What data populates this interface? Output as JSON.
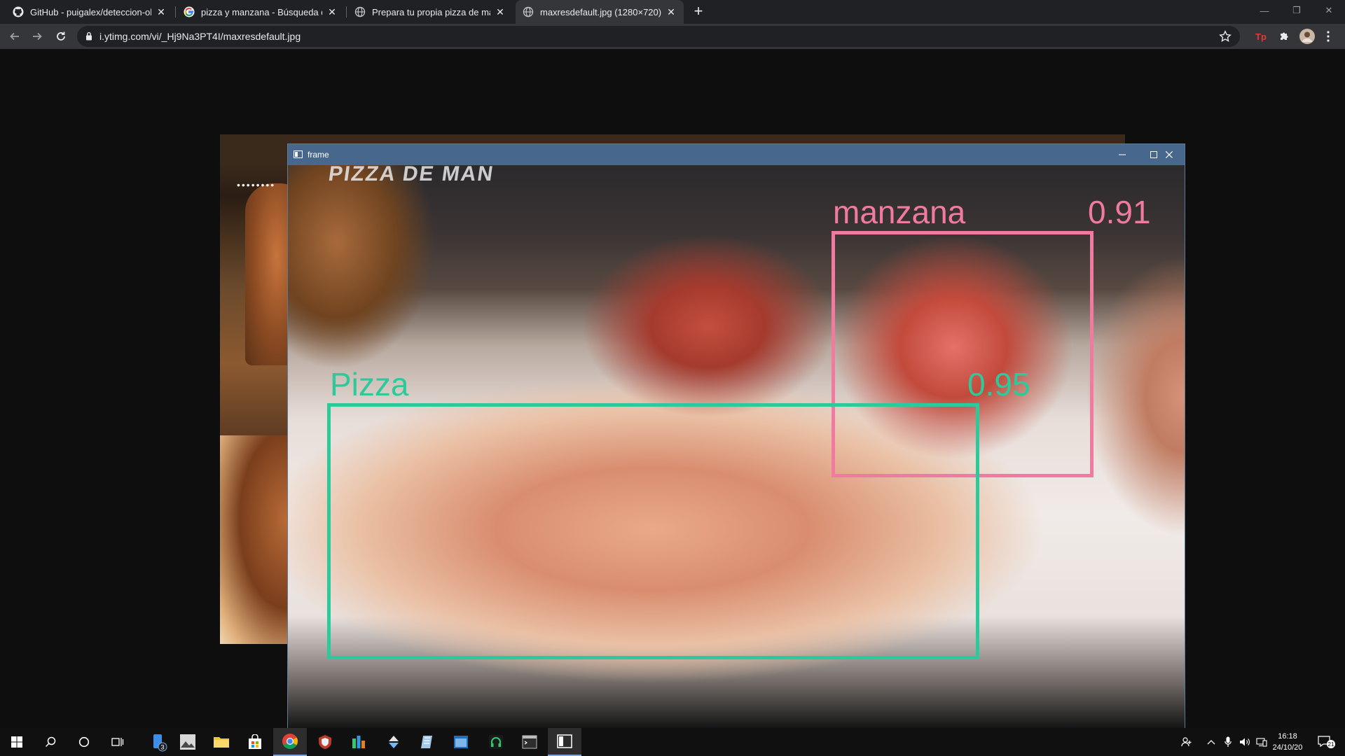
{
  "browser": {
    "tabs": [
      {
        "title": "GitHub - puigalex/deteccion-obj",
        "favicon": "github-icon",
        "active": false
      },
      {
        "title": "pizza y manzana - Búsqueda de",
        "favicon": "google-icon",
        "active": false
      },
      {
        "title": "Prepara tu propia pizza de manzana",
        "favicon": "globe-icon",
        "active": false
      },
      {
        "title": "maxresdefault.jpg (1280×720)",
        "favicon": "globe-icon",
        "active": true
      }
    ],
    "new_tab_label": "+",
    "url": "i.ytimg.com/vi/_Hj9Na3PT4I/maxresdefault.jpg"
  },
  "cv_window": {
    "title": "frame",
    "detections": [
      {
        "label": "manzana",
        "score": "0.91",
        "color": "#f07aa0"
      },
      {
        "label": "Pizza",
        "score": "0.95",
        "color": "#2dc99b"
      }
    ],
    "frame_caption": "PIZZA DE MAN"
  },
  "taskbar": {
    "store_badge": "3",
    "clock_time": "16:18",
    "clock_date": "24/10/20",
    "notification_count": "21"
  },
  "colors": {
    "titlebar": "#47688c",
    "tab_active": "#35363a",
    "tab_strip": "#202124"
  }
}
